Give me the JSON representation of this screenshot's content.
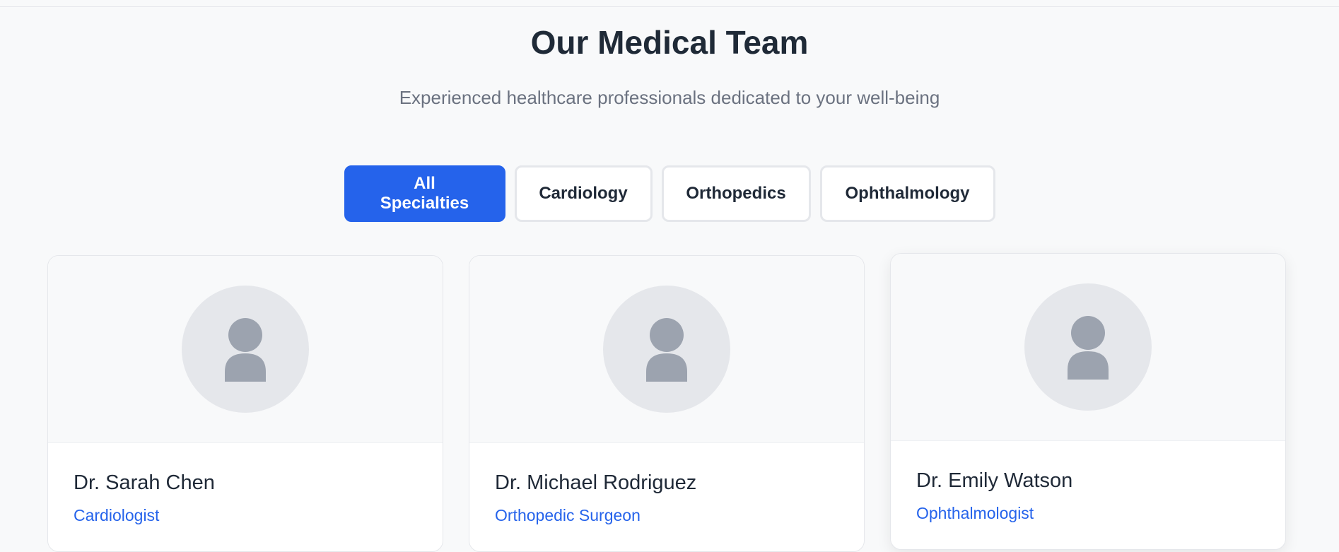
{
  "header": {
    "title": "Our Medical Team",
    "subtitle": "Experienced healthcare professionals dedicated to your well-being"
  },
  "filters": [
    {
      "label": "All Specialties",
      "active": true
    },
    {
      "label": "Cardiology",
      "active": false
    },
    {
      "label": "Orthopedics",
      "active": false
    },
    {
      "label": "Ophthalmology",
      "active": false
    }
  ],
  "doctors": [
    {
      "name": "Dr. Sarah Chen",
      "specialty": "Cardiologist",
      "avatar_icon": "person-placeholder-icon"
    },
    {
      "name": "Dr. Michael Rodriguez",
      "specialty": "Orthopedic Surgeon",
      "avatar_icon": "person-placeholder-icon"
    },
    {
      "name": "Dr. Emily Watson",
      "specialty": "Ophthalmologist",
      "avatar_icon": "person-placeholder-icon"
    }
  ],
  "colors": {
    "accent": "#2563eb",
    "page_background": "#f8f9fa",
    "text_primary": "#1f2937",
    "text_secondary": "#6b7280",
    "avatar_bg": "#e5e7eb",
    "avatar_icon": "#9ca3af"
  }
}
